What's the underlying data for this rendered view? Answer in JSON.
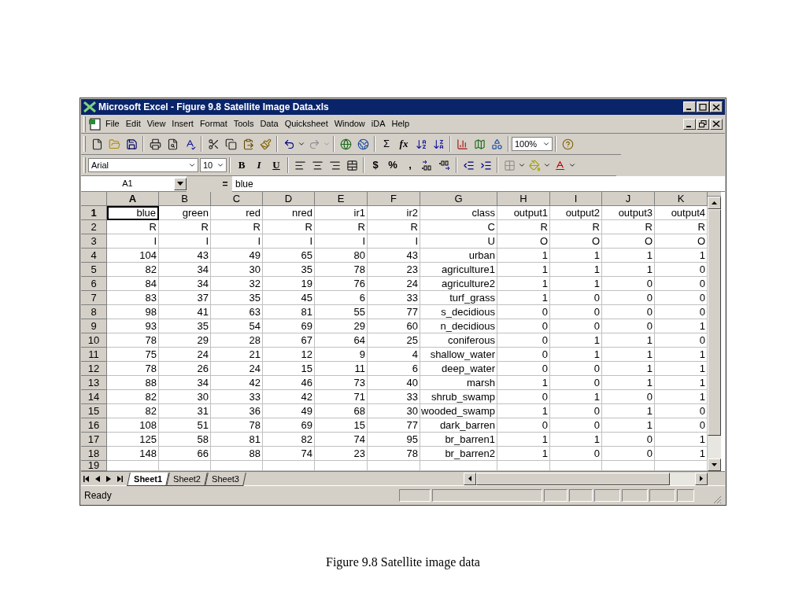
{
  "window": {
    "title": "Microsoft Excel - Figure 9.8 Satellite Image Data.xls"
  },
  "menu": [
    "File",
    "Edit",
    "View",
    "Insert",
    "Format",
    "Tools",
    "Data",
    "Quicksheet",
    "Window",
    "iDA",
    "Help"
  ],
  "standard_toolbar": {
    "autosum": "Σ",
    "function": "fx",
    "zoom": "100%"
  },
  "formatting_toolbar": {
    "font": "Arial",
    "size": "10",
    "bold": "B",
    "italic": "I",
    "underline": "U",
    "currency": "$",
    "percent": "%",
    "comma": ","
  },
  "formula_bar": {
    "name_box": "A1",
    "equals": "=",
    "value": "blue"
  },
  "sheet": {
    "columns": [
      {
        "label": "A",
        "selected": true
      },
      {
        "label": "B",
        "selected": false
      },
      {
        "label": "C",
        "selected": false
      },
      {
        "label": "D",
        "selected": false
      },
      {
        "label": "E",
        "selected": false
      },
      {
        "label": "F",
        "selected": false
      },
      {
        "label": "G",
        "selected": false
      },
      {
        "label": "H",
        "selected": false
      },
      {
        "label": "I",
        "selected": false
      },
      {
        "label": "J",
        "selected": false
      },
      {
        "label": "K",
        "selected": false
      }
    ],
    "rows": [
      {
        "header": "1",
        "selected": true,
        "cells": [
          "blue",
          "green",
          "red",
          "nred",
          "ir1",
          "ir2",
          "class",
          "output1",
          "output2",
          "output3",
          "output4"
        ]
      },
      {
        "header": "2",
        "selected": false,
        "cells": [
          "R",
          "R",
          "R",
          "R",
          "R",
          "R",
          "C",
          "R",
          "R",
          "R",
          "R"
        ]
      },
      {
        "header": "3",
        "selected": false,
        "cells": [
          "I",
          "I",
          "I",
          "I",
          "I",
          "I",
          "U",
          "O",
          "O",
          "O",
          "O"
        ]
      },
      {
        "header": "4",
        "selected": false,
        "cells": [
          "104",
          "43",
          "49",
          "65",
          "80",
          "43",
          "urban",
          "1",
          "1",
          "1",
          "1"
        ]
      },
      {
        "header": "5",
        "selected": false,
        "cells": [
          "82",
          "34",
          "30",
          "35",
          "78",
          "23",
          "agriculture1",
          "1",
          "1",
          "1",
          "0"
        ]
      },
      {
        "header": "6",
        "selected": false,
        "cells": [
          "84",
          "34",
          "32",
          "19",
          "76",
          "24",
          "agriculture2",
          "1",
          "1",
          "0",
          "0"
        ]
      },
      {
        "header": "7",
        "selected": false,
        "cells": [
          "83",
          "37",
          "35",
          "45",
          "6",
          "33",
          "turf_grass",
          "1",
          "0",
          "0",
          "0"
        ]
      },
      {
        "header": "8",
        "selected": false,
        "cells": [
          "98",
          "41",
          "63",
          "81",
          "55",
          "77",
          "s_decidious",
          "0",
          "0",
          "0",
          "0"
        ]
      },
      {
        "header": "9",
        "selected": false,
        "cells": [
          "93",
          "35",
          "54",
          "69",
          "29",
          "60",
          "n_decidious",
          "0",
          "0",
          "0",
          "1"
        ]
      },
      {
        "header": "10",
        "selected": false,
        "cells": [
          "78",
          "29",
          "28",
          "67",
          "64",
          "25",
          "coniferous",
          "0",
          "1",
          "1",
          "0"
        ]
      },
      {
        "header": "11",
        "selected": false,
        "cells": [
          "75",
          "24",
          "21",
          "12",
          "9",
          "4",
          "shallow_water",
          "0",
          "1",
          "1",
          "1"
        ]
      },
      {
        "header": "12",
        "selected": false,
        "cells": [
          "78",
          "26",
          "24",
          "15",
          "11",
          "6",
          "deep_water",
          "0",
          "0",
          "1",
          "1"
        ]
      },
      {
        "header": "13",
        "selected": false,
        "cells": [
          "88",
          "34",
          "42",
          "46",
          "73",
          "40",
          "marsh",
          "1",
          "0",
          "1",
          "1"
        ]
      },
      {
        "header": "14",
        "selected": false,
        "cells": [
          "82",
          "30",
          "33",
          "42",
          "71",
          "33",
          "shrub_swamp",
          "0",
          "1",
          "0",
          "1"
        ]
      },
      {
        "header": "15",
        "selected": false,
        "cells": [
          "82",
          "31",
          "36",
          "49",
          "68",
          "30",
          "wooded_swamp",
          "1",
          "0",
          "1",
          "0"
        ]
      },
      {
        "header": "16",
        "selected": false,
        "cells": [
          "108",
          "51",
          "78",
          "69",
          "15",
          "77",
          "dark_barren",
          "0",
          "0",
          "1",
          "0"
        ]
      },
      {
        "header": "17",
        "selected": false,
        "cells": [
          "125",
          "58",
          "81",
          "82",
          "74",
          "95",
          "br_barren1",
          "1",
          "1",
          "0",
          "1"
        ]
      },
      {
        "header": "18",
        "selected": false,
        "cells": [
          "148",
          "66",
          "88",
          "74",
          "23",
          "78",
          "br_barren2",
          "1",
          "0",
          "0",
          "1"
        ]
      },
      {
        "header": "19",
        "selected": false,
        "cells": []
      }
    ]
  },
  "sheet_tabs": [
    {
      "label": "Sheet1",
      "selected": true
    },
    {
      "label": "Sheet2",
      "selected": false
    },
    {
      "label": "Sheet3",
      "selected": false
    }
  ],
  "status_bar": {
    "text": "Ready"
  },
  "caption": "Figure 9.8 Satellite image data"
}
